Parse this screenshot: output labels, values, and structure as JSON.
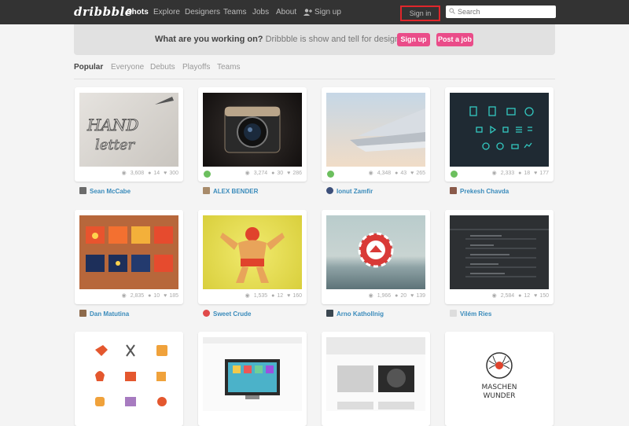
{
  "header": {
    "logo": "dribbble",
    "nav": [
      "Shots",
      "Explore",
      "Designers",
      "Teams",
      "Jobs",
      "About",
      "Sign up"
    ],
    "signin": "Sign in",
    "search_placeholder": "Search"
  },
  "banner": {
    "bold": "What are you working on?",
    "rest": " Dribbble is show and tell for designers.",
    "signup": "Sign up",
    "post_job": "Post a job"
  },
  "tabs": [
    "Popular",
    "Everyone",
    "Debuts",
    "Playoffs",
    "Teams"
  ],
  "shots": [
    {
      "views": "3,608",
      "comments": "14",
      "likes": "300",
      "author": "Sean McCabe",
      "rebound": false
    },
    {
      "views": "3,274",
      "comments": "30",
      "likes": "286",
      "author": "ALEX BENDER",
      "rebound": true
    },
    {
      "views": "4,348",
      "comments": "43",
      "likes": "265",
      "author": "Ionut Zamfir",
      "rebound": true
    },
    {
      "views": "2,333",
      "comments": "18",
      "likes": "177",
      "author": "Prekesh Chavda",
      "rebound": true
    },
    {
      "views": "2,835",
      "comments": "10",
      "likes": "185",
      "author": "Dan Matutina",
      "rebound": false
    },
    {
      "views": "1,535",
      "comments": "12",
      "likes": "160",
      "author": "Sweet Crude",
      "rebound": false
    },
    {
      "views": "1,966",
      "comments": "20",
      "likes": "139",
      "author": "Arno Kathollnig",
      "rebound": false
    },
    {
      "views": "2,584",
      "comments": "12",
      "likes": "150",
      "author": "Vilém Ries",
      "rebound": false
    },
    {
      "views": "",
      "comments": "",
      "likes": "",
      "author": "",
      "rebound": false
    },
    {
      "views": "",
      "comments": "",
      "likes": "",
      "author": "",
      "rebound": false
    },
    {
      "views": "",
      "comments": "",
      "likes": "",
      "author": "",
      "rebound": false
    },
    {
      "views": "",
      "comments": "",
      "likes": "",
      "author": "",
      "rebound": false
    }
  ]
}
